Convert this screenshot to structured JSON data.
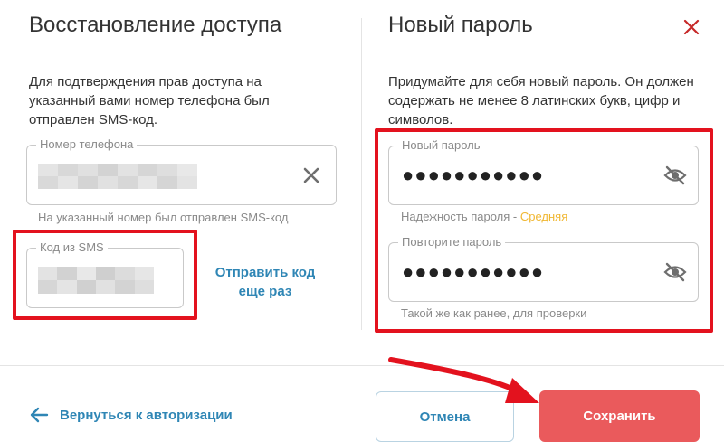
{
  "left_panel": {
    "title": "Восстановление доступа",
    "description": "Для подтверждения прав доступа на указанный вами номер телефона был отправлен SMS-код.",
    "phone_field": {
      "label": "Номер телефона",
      "value_masked": true
    },
    "phone_helper": "На указанный номер был отправлен SMS-код",
    "sms_field": {
      "label": "Код из SMS",
      "value_masked": true
    },
    "resend": {
      "line1": "Отправить код",
      "line2": "еще раз"
    }
  },
  "right_panel": {
    "title": "Новый пароль",
    "description": "Придумайте для себя новый пароль. Он должен содержать не менее 8 латинских букв, цифр и символов.",
    "new_password": {
      "label": "Новый пароль",
      "value": "●●●●●●●●●●●"
    },
    "strength": {
      "prefix": "Надежность пароля - ",
      "level": "Средняя"
    },
    "repeat_password": {
      "label": "Повторите пароль",
      "value": "●●●●●●●●●●●"
    },
    "repeat_helper": "Такой же как ранее, для проверки"
  },
  "footer": {
    "back_label": "Вернуться к авторизации",
    "cancel_label": "Отмена",
    "save_label": "Сохранить"
  },
  "icons": {
    "close": "close-icon",
    "clear": "clear-icon",
    "eye": "eye-off-icon",
    "back": "arrow-left-icon"
  },
  "colors": {
    "accent": "#2f86b5",
    "save": "#ea5a5c",
    "highlight": "#e3121e",
    "strength_medium": "#f0b732"
  }
}
